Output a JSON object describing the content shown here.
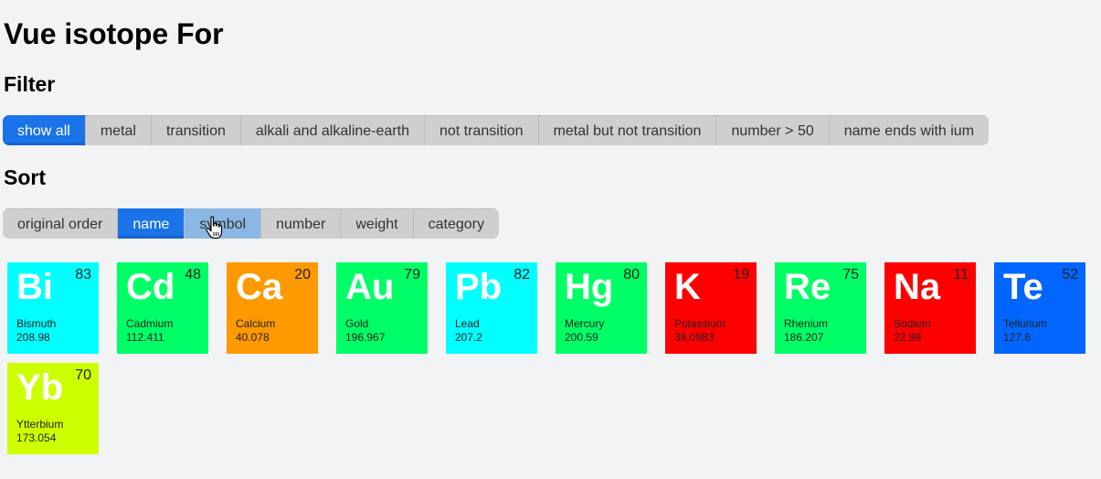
{
  "title": "Vue isotope For",
  "filter": {
    "heading": "Filter",
    "buttons": [
      "show all",
      "metal",
      "transition",
      "alkali and alkaline-earth",
      "not transition",
      "metal but not transition",
      "number > 50",
      "name ends with ium"
    ],
    "active": "show all"
  },
  "sort": {
    "heading": "Sort",
    "buttons": [
      "original order",
      "name",
      "symbol",
      "number",
      "weight",
      "category"
    ],
    "active": "name",
    "hovered": "symbol"
  },
  "elements": [
    {
      "symbol": "Bi",
      "number": "83",
      "name": "Bismuth",
      "weight": "208.98",
      "color": "#00ffff"
    },
    {
      "symbol": "Cd",
      "number": "48",
      "name": "Cadmium",
      "weight": "112.411",
      "color": "#00ff66"
    },
    {
      "symbol": "Ca",
      "number": "20",
      "name": "Calcium",
      "weight": "40.078",
      "color": "#ff9900"
    },
    {
      "symbol": "Au",
      "number": "79",
      "name": "Gold",
      "weight": "196.967",
      "color": "#00ff66"
    },
    {
      "symbol": "Pb",
      "number": "82",
      "name": "Lead",
      "weight": "207.2",
      "color": "#00ffff"
    },
    {
      "symbol": "Hg",
      "number": "80",
      "name": "Mercury",
      "weight": "200.59",
      "color": "#00ff66"
    },
    {
      "symbol": "K",
      "number": "19",
      "name": "Potassium",
      "weight": "39.0983",
      "color": "#ff0000"
    },
    {
      "symbol": "Re",
      "number": "75",
      "name": "Rhenium",
      "weight": "186.207",
      "color": "#00ff66"
    },
    {
      "symbol": "Na",
      "number": "11",
      "name": "Sodium",
      "weight": "22.99",
      "color": "#ff0000"
    },
    {
      "symbol": "Te",
      "number": "52",
      "name": "Tellurium",
      "weight": "127.6",
      "color": "#0066ff"
    },
    {
      "symbol": "Yb",
      "number": "70",
      "name": "Ytterbium",
      "weight": "173.054",
      "color": "#ccff00"
    }
  ]
}
